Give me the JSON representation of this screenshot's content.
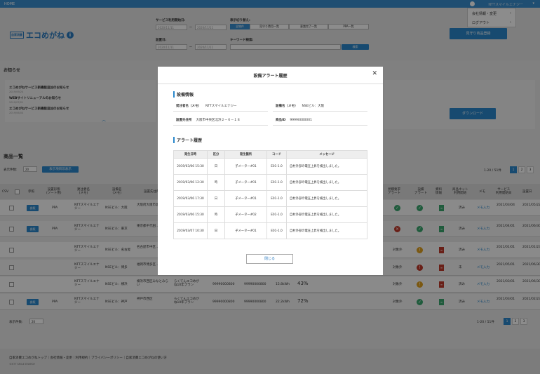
{
  "topbar": {
    "home": "HOME",
    "user": "NTTスマイルエナジー",
    "caret": "▾"
  },
  "usermenu": {
    "company": "会社情報・変更",
    "logout": "ログアウト",
    "arrow": "›"
  },
  "logo": {
    "tag": "自家消費",
    "name": "エコめがね",
    "info": "i"
  },
  "filters": {
    "service_start_label": "サービス利用開始日:",
    "install_date_label": "設置日:",
    "date_placeholder": "2020/11/11",
    "tilde": "〜",
    "view_switch_label": "表示切り替え:",
    "view_tabs": [
      "全物件",
      "見守り費用一覧",
      "意識完了一覧",
      "PPA一覧"
    ],
    "keyword_label": "キーワード検索:",
    "search": "検索",
    "watch_btn": "見守り商品登録",
    "download": "ダウンロード"
  },
  "notice": {
    "title": "お知らせ",
    "items": [
      {
        "title": "エコめがねサービス新機能追加のお知らせ",
        "date": "2019/09/24"
      },
      {
        "title": "WEBサイトリニューアルのお知らせ",
        "date": "2019/07/01"
      },
      {
        "title": "エコめがねサービス新機能追加のお知らせ",
        "date": "2019/06/04"
      }
    ],
    "more": "︿"
  },
  "list": {
    "title": "商品一覧",
    "per_page_label": "表示件数:",
    "per_page": "20",
    "toggle_btn": "表示項目非表示",
    "count": "1-20 / 51件",
    "pages": [
      "1",
      "2",
      "3"
    ]
  },
  "table": {
    "headers": [
      "CSV",
      "参照",
      "設置形態\n(ソート用)",
      "発注者名\n(メモ)",
      "設備名\n(メモ)",
      "設置先住所",
      "",
      "",
      "",
      "",
      "",
      "",
      "見積要求\nアラート",
      "設備\nアラート",
      "資料\n情報",
      "商品ネット\n利用開始",
      "メモ",
      "サービス\n利用開始日",
      "設置日"
    ],
    "rows": [
      {
        "ref": "参照",
        "type": "PPA",
        "owner": "NTTスマイルエナジー",
        "equip": "NSEビル：大阪",
        "addr": "大阪府大阪市北区…",
        "status1": "ok",
        "status2": "ok",
        "doc": "green",
        "pay": "済み",
        "memo": "メモ入力",
        "start": "2021/03/04",
        "install": "2021/05/22"
      },
      {
        "ref": "参照",
        "type": "PPA",
        "owner": "NTTスマイルエナジー",
        "equip": "NSEビル：東京",
        "addr": "東京都千代田…",
        "status1": "ng",
        "status2": "ok",
        "doc": "green",
        "pay": "済み",
        "memo": "メモ入力",
        "start": "2021/04/01",
        "install": "2021/06/30"
      },
      {
        "ref": "",
        "type": "",
        "owner": "NTTスマイルエナジー",
        "equip": "NSEビル：名古屋",
        "addr": "名古屋市中区…",
        "status1": "対象外",
        "status2": "warn",
        "doc": "red",
        "pay": "済み",
        "memo": "メモ入力",
        "start": "2021/01/01",
        "install": "2021/01/23"
      },
      {
        "ref": "",
        "type": "",
        "owner": "NTTスマイルエナジー",
        "equip": "NSEビル：博多",
        "addr": "福岡市博多区…",
        "status1": "対象外",
        "status2": "ng",
        "doc": "red",
        "pay": "未",
        "memo": "メモ入力",
        "start": "2021/05/01",
        "install": "2021/06/30"
      },
      {
        "ref": "",
        "type": "",
        "owner": "NTTスマイルエナジー",
        "equip": "NSEビル：横浜",
        "addr": "横浜市西区みなとみらい",
        "status1": "対象外",
        "status2": "warn",
        "doc": "red",
        "pay": "済み",
        "memo": "メモ入力",
        "start": "2021/03/01",
        "install": "2021/06/30",
        "plan": "らくてんエコめがね10年プラン",
        "num1": "99990000800",
        "num2": "99990000800",
        "kwh": "15.8kWh",
        "pct": "43%"
      },
      {
        "ref": "参照",
        "type": "PPA",
        "owner": "NTTスマイルエナジー",
        "equip": "NSEビル：神戸",
        "addr": "神戸市西区",
        "status1": "対象外",
        "status2": "ok",
        "doc": "green",
        "pay": "済み",
        "memo": "メモ入力",
        "start": "2021/03/01",
        "install": "2021/02/23",
        "plan": "らくてんエコめがね10年プラン",
        "num1": "99990000800",
        "num2": "99990000800",
        "kwh": "22.2kWh",
        "pct": "72%"
      }
    ]
  },
  "footer": {
    "links": "自家消費エコめがねトップ｜会社情報・変更｜利用規約｜プライバシーポリシー｜自家消費エコめがねの使い方",
    "copy": "©NTT SMILE ENERGY"
  },
  "modal": {
    "title": "設備アラート履歴",
    "close_icon": "✕",
    "sec1": "設備情報",
    "owner_label": "発注者名（メモ）",
    "owner": "NTTスマイルエナジー",
    "equip_label": "設備名（メモ）",
    "equip": "NSEビル：大阪",
    "addr_label": "設置先住所",
    "addr": "大阪市中央区北浜２－６－１８",
    "id_label": "商品ID",
    "id": "99990000001",
    "sec2": "アラート履歴",
    "headers": [
      "発生日時",
      "区分",
      "発生箇所",
      "コード",
      "メッセージ"
    ],
    "rows": [
      [
        "2019/03/06 15:30",
        "日",
        "子メーター#01",
        "E01-1.0",
        "自村外部の電圧上昇を検出しました。"
      ],
      [
        "2019/03/06 12:30",
        "時",
        "子メーター#01",
        "E01-1.0",
        "自村外部の電圧上昇を検出しました。"
      ],
      [
        "2019/03/06 17:30",
        "日",
        "子メーター#01",
        "E01-1.0",
        "自村外部の電圧上昇を検出しました。"
      ],
      [
        "2019/03/06 15:30",
        "時",
        "子メーター#02",
        "E01-1.0",
        "自村外部の電圧上昇を検出しました。"
      ],
      [
        "2019/03/07 10:30",
        "日",
        "子メーター#01",
        "E01-1.0",
        "自村外部の電圧上昇を検出しました。"
      ]
    ],
    "close_btn": "閉じる"
  }
}
